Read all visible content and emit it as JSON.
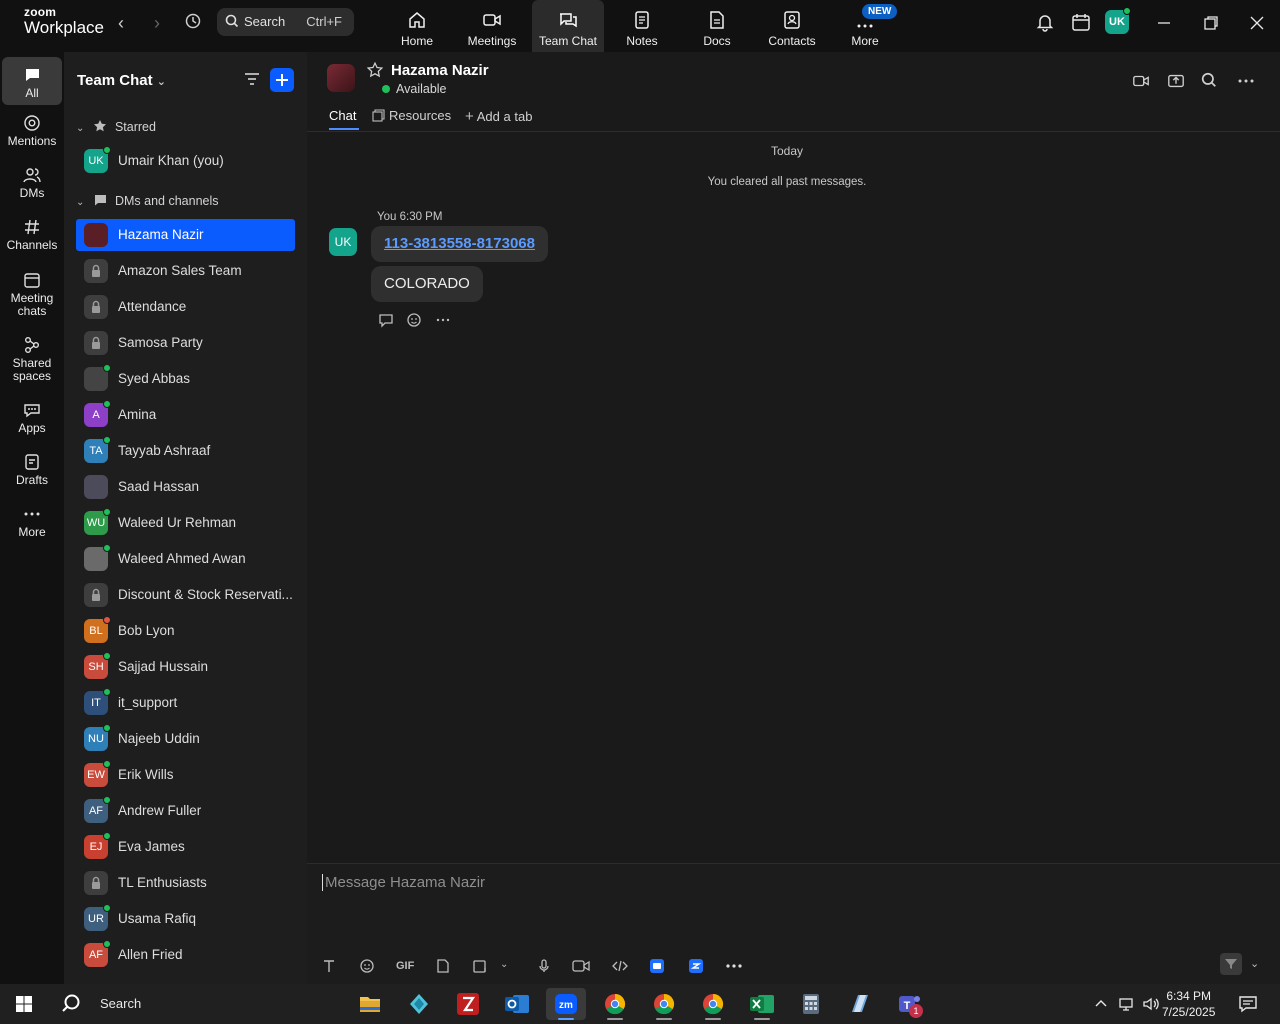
{
  "app": {
    "logo_line1": "zoom",
    "logo_line2": "Workplace"
  },
  "search": {
    "label": "Search",
    "shortcut": "Ctrl+F"
  },
  "top_nav": [
    {
      "label": "Home",
      "icon": "home-icon"
    },
    {
      "label": "Meetings",
      "icon": "video-camera-icon"
    },
    {
      "label": "Team Chat",
      "icon": "chat-icon",
      "active": true
    },
    {
      "label": "Notes",
      "icon": "notes-icon"
    },
    {
      "label": "Docs",
      "icon": "docs-icon"
    },
    {
      "label": "Contacts",
      "icon": "contacts-icon"
    },
    {
      "label": "More",
      "icon": "more-icon",
      "badge": "NEW"
    }
  ],
  "user": {
    "initials": "UK",
    "status_color": "#1fbf5a"
  },
  "rail": [
    {
      "label": "All",
      "icon": "chat-bubble-icon",
      "active": true
    },
    {
      "label": "Mentions",
      "icon": "at-sign-icon"
    },
    {
      "label": "DMs",
      "icon": "people-icon"
    },
    {
      "label": "Channels",
      "icon": "hash-icon"
    },
    {
      "label": "Meeting chats",
      "label_line1": "Meeting",
      "label_line2": "chats",
      "icon": "calendar-icon"
    },
    {
      "label": "Shared spaces",
      "label_line1": "Shared",
      "label_line2": "spaces",
      "icon": "share-nodes-icon"
    },
    {
      "label": "Apps",
      "icon": "apps-icon"
    },
    {
      "label": "Drafts",
      "icon": "drafts-icon"
    },
    {
      "label": "More",
      "icon": "ellipsis-icon"
    }
  ],
  "sidebar": {
    "title": "Team Chat",
    "starred_label": "Starred",
    "dms_label": "DMs and channels",
    "starred": [
      {
        "name": "Umair Khan (you)",
        "initials": "UK",
        "color": "#14a38b",
        "online": true
      }
    ],
    "items": [
      {
        "name": "Hazama Nazir",
        "initials": "",
        "color": "#5a1e26",
        "online": false,
        "active": true
      },
      {
        "name": "Amazon Sales Team",
        "lock": true
      },
      {
        "name": "Attendance",
        "lock": true
      },
      {
        "name": "Samosa Party",
        "lock": true
      },
      {
        "name": "Syed Abbas",
        "initials": "",
        "color": "#444444",
        "online": true
      },
      {
        "name": "Amina",
        "initials": "A",
        "color": "#8e3fc7",
        "online": true
      },
      {
        "name": "Tayyab Ashraaf",
        "initials": "TA",
        "color": "#2f7fb8",
        "online": true
      },
      {
        "name": "Saad Hassan",
        "initials": "",
        "color": "#4b4b5a",
        "online": false
      },
      {
        "name": "Waleed Ur Rehman",
        "initials": "WU",
        "color": "#2e9b4a",
        "online": true
      },
      {
        "name": "Waleed Ahmed Awan",
        "initials": "",
        "color": "#6a6a6a",
        "online": true
      },
      {
        "name": "Discount & Stock Reservati...",
        "lock": true
      },
      {
        "name": "Bob Lyon",
        "initials": "BL",
        "color": "#d0701e",
        "online": false,
        "phone": true
      },
      {
        "name": "Sajjad Hussain",
        "initials": "SH",
        "color": "#c84b3c",
        "online": true
      },
      {
        "name": "it_support",
        "initials": "IT",
        "color": "#2d4f7a",
        "online": true
      },
      {
        "name": "Najeeb Uddin",
        "initials": "NU",
        "color": "#2f7fb8",
        "online": true
      },
      {
        "name": "Erik Wills",
        "initials": "EW",
        "color": "#c84b3c",
        "online": true
      },
      {
        "name": "Andrew Fuller",
        "initials": "AF",
        "color": "#3f5f7f",
        "online": true
      },
      {
        "name": "Eva James",
        "initials": "EJ",
        "color": "#c8402f",
        "online": true
      },
      {
        "name": "TL Enthusiasts",
        "lock": true
      },
      {
        "name": "Usama Rafiq",
        "initials": "UR",
        "color": "#3f5f7f",
        "online": true
      },
      {
        "name": "Allen Fried",
        "initials": "AF",
        "color": "#c84b3c",
        "online": true
      }
    ]
  },
  "chat": {
    "contact_name": "Hazama Nazir",
    "status": "Available",
    "tabs": [
      "Chat",
      "Resources",
      "Add a tab"
    ],
    "day_separator": "Today",
    "system_message": "You cleared all past messages.",
    "message_author": "You",
    "message_time": "6:30 PM",
    "message_avatar": "UK",
    "messages": [
      {
        "text": "113-3813558-8173068",
        "is_link": true
      },
      {
        "text": "COLORADO",
        "is_link": false
      }
    ],
    "composer_placeholder": "Message Hazama Nazir",
    "gif_label": "GIF"
  },
  "taskbar": {
    "search_label": "Search",
    "time": "6:34 PM",
    "date": "7/25/2025",
    "teams_badge": "1"
  }
}
